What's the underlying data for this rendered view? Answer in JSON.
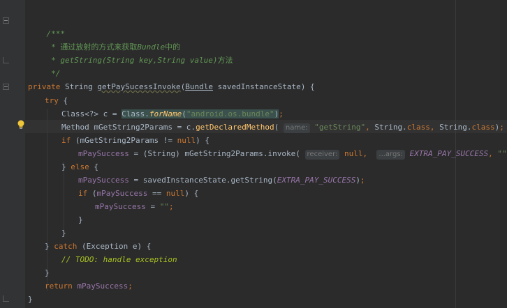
{
  "colors": {
    "background": "#2b2b2b",
    "keyword": "#cc7832",
    "comment": "#629755",
    "string": "#6a8759",
    "field": "#9876aa",
    "text": "#a9b7c6"
  },
  "code": {
    "doc_open": "/***",
    "doc_line1_prefix": " * 通过放射的方式来获取",
    "doc_line1_em": "Bundle",
    "doc_line1_suffix": "中的",
    "doc_line2_prefix": " * ",
    "doc_line2_em": "getString(String key,String value)",
    "doc_line2_suffix": "方法",
    "doc_close": " */",
    "kw_private": "private",
    "type_string": "String",
    "method_name": "getPaySucessInvoke",
    "type_bundle": "Bundle",
    "param_name": "savedInstanceState",
    "kw_try": "try",
    "class_decl": "Class<?> c = ",
    "class_ref": "Class",
    "forname": "forName",
    "string_android": "\"android.os.bundle\"",
    "method_decl": "Method mGetString2Params = c.",
    "get_declared_method": "getDeclaredMethod",
    "hint_name": "name:",
    "string_getstring": "\"getString\"",
    "class_kw": "class",
    "kw_if": "if",
    "if_cond_pre": "(mGetString2Params != ",
    "kw_null": "null",
    "field_paysuccess": "mPaySuccess",
    "cast_invoke": " = (String) mGetString2Params.invoke(",
    "hint_receiver": "receiver:",
    "hint_args": "...args:",
    "const_extra": "EXTRA_PAY_SUCCESS",
    "string_empty": "\"\"",
    "kw_else": "else",
    "get_string_call": " = savedInstanceState.getString(",
    "if_cond2_pre": "(",
    "if_cond2_mid": " == ",
    "kw_catch": "catch",
    "exception_param": "(Exception e) {",
    "todo_comment": "// TODO: handle exception",
    "kw_return": "return"
  }
}
